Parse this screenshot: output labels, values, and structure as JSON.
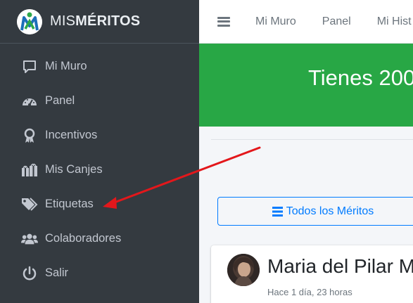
{
  "brand": {
    "prefix": "MIS",
    "suffix": "MÉRITOS"
  },
  "sidebar": {
    "items": [
      {
        "label": "Mi Muro",
        "icon": "comment-icon"
      },
      {
        "label": "Panel",
        "icon": "dashboard-icon"
      },
      {
        "label": "Incentivos",
        "icon": "award-icon"
      },
      {
        "label": "Mis Canjes",
        "icon": "gifts-icon"
      },
      {
        "label": "Etiquetas",
        "icon": "tags-icon"
      },
      {
        "label": "Colaboradores",
        "icon": "users-icon"
      },
      {
        "label": "Salir",
        "icon": "power-icon"
      }
    ]
  },
  "topbar": {
    "links": [
      "Mi Muro",
      "Panel",
      "Mi Hist"
    ]
  },
  "banner": {
    "text": "Tienes 200"
  },
  "main": {
    "all_button_label": "Todos los Méritos",
    "post": {
      "author": "Maria del Pilar M",
      "time": "Hace 1 día, 23 horas"
    }
  },
  "colors": {
    "sidebar": "#343a40",
    "banner": "#28a745",
    "primary": "#007bff",
    "arrow": "#e3171b"
  }
}
